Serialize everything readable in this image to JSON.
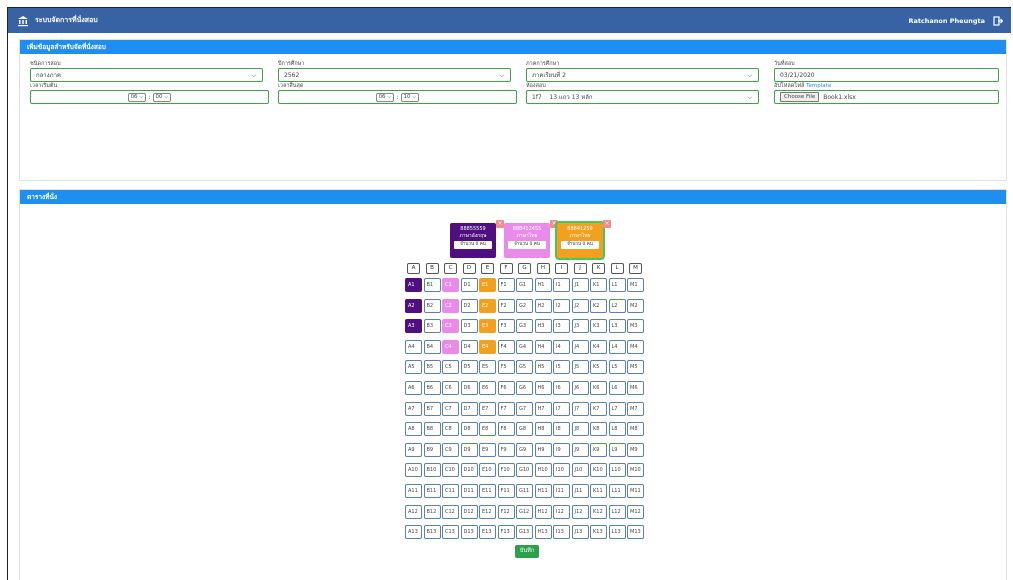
{
  "header": {
    "title": "ระบบจัดการที่นั่งสอบ",
    "user_name": "Ratchanon Pheungta"
  },
  "settings_panel": {
    "title": "เพิ่มข้อมูลสำหรับจัดที่นั่งสอบ",
    "exam_type": {
      "label": "ชนิดการสอบ",
      "value": "กลางภาค"
    },
    "academic_year": {
      "label": "ปีการศึกษา",
      "value": "2562"
    },
    "semester": {
      "label": "ภาคการศึกษา",
      "value": "ภาคเรียนที่ 2"
    },
    "exam_date": {
      "label": "วันที่สอบ",
      "value": "03/21/2020"
    },
    "start_time": {
      "label": "เวลาเริ่มต้น",
      "hour": "06",
      "minute": "00"
    },
    "end_time": {
      "label": "เวลาสิ้นสุด",
      "hour": "06",
      "minute": "10"
    },
    "exam_room": {
      "label": "ห้องสอบ",
      "value": "1f7    13 แถว 13 หลัก"
    },
    "upload": {
      "label": "อัปโหลดไฟล์",
      "link": "Template",
      "button": "Choose File",
      "file_name": "Book1.xlsx"
    }
  },
  "seating_panel": {
    "title": "ตารางที่นั่ง",
    "cards": [
      {
        "code": "88855559",
        "subject": "ภาษาอังกฤษ",
        "count": "จำนวน 0 คน",
        "color": "#4f0f7e",
        "selected": false
      },
      {
        "code": "88841245S",
        "subject": "ภาษาไทย",
        "count": "จำนวน 0 คน",
        "color": "#e98ce9",
        "selected": false
      },
      {
        "code": "88841259",
        "subject": "ภาษาไทย",
        "count": "จำนวน 0 คน",
        "color": "#f4a01f",
        "selected": true
      }
    ],
    "columns": [
      "A",
      "B",
      "C",
      "D",
      "E",
      "F",
      "G",
      "H",
      "I",
      "J",
      "K",
      "L",
      "M"
    ],
    "rows": 13,
    "seat_colors": {
      "A1": "purple",
      "A2": "purple",
      "A3": "purple",
      "C1": "pink",
      "C2": "pink",
      "C3": "pink",
      "C4": "pink",
      "E1": "orange",
      "E2": "orange",
      "E3": "orange",
      "E4": "orange"
    },
    "save_label": "บันทึก"
  },
  "colors": {
    "topbar": "#3763a5",
    "panel_header": "#1f8ef1",
    "input_border": "#3fa14a",
    "seat_border": "#5a82ad",
    "save_button": "#2da04b"
  }
}
